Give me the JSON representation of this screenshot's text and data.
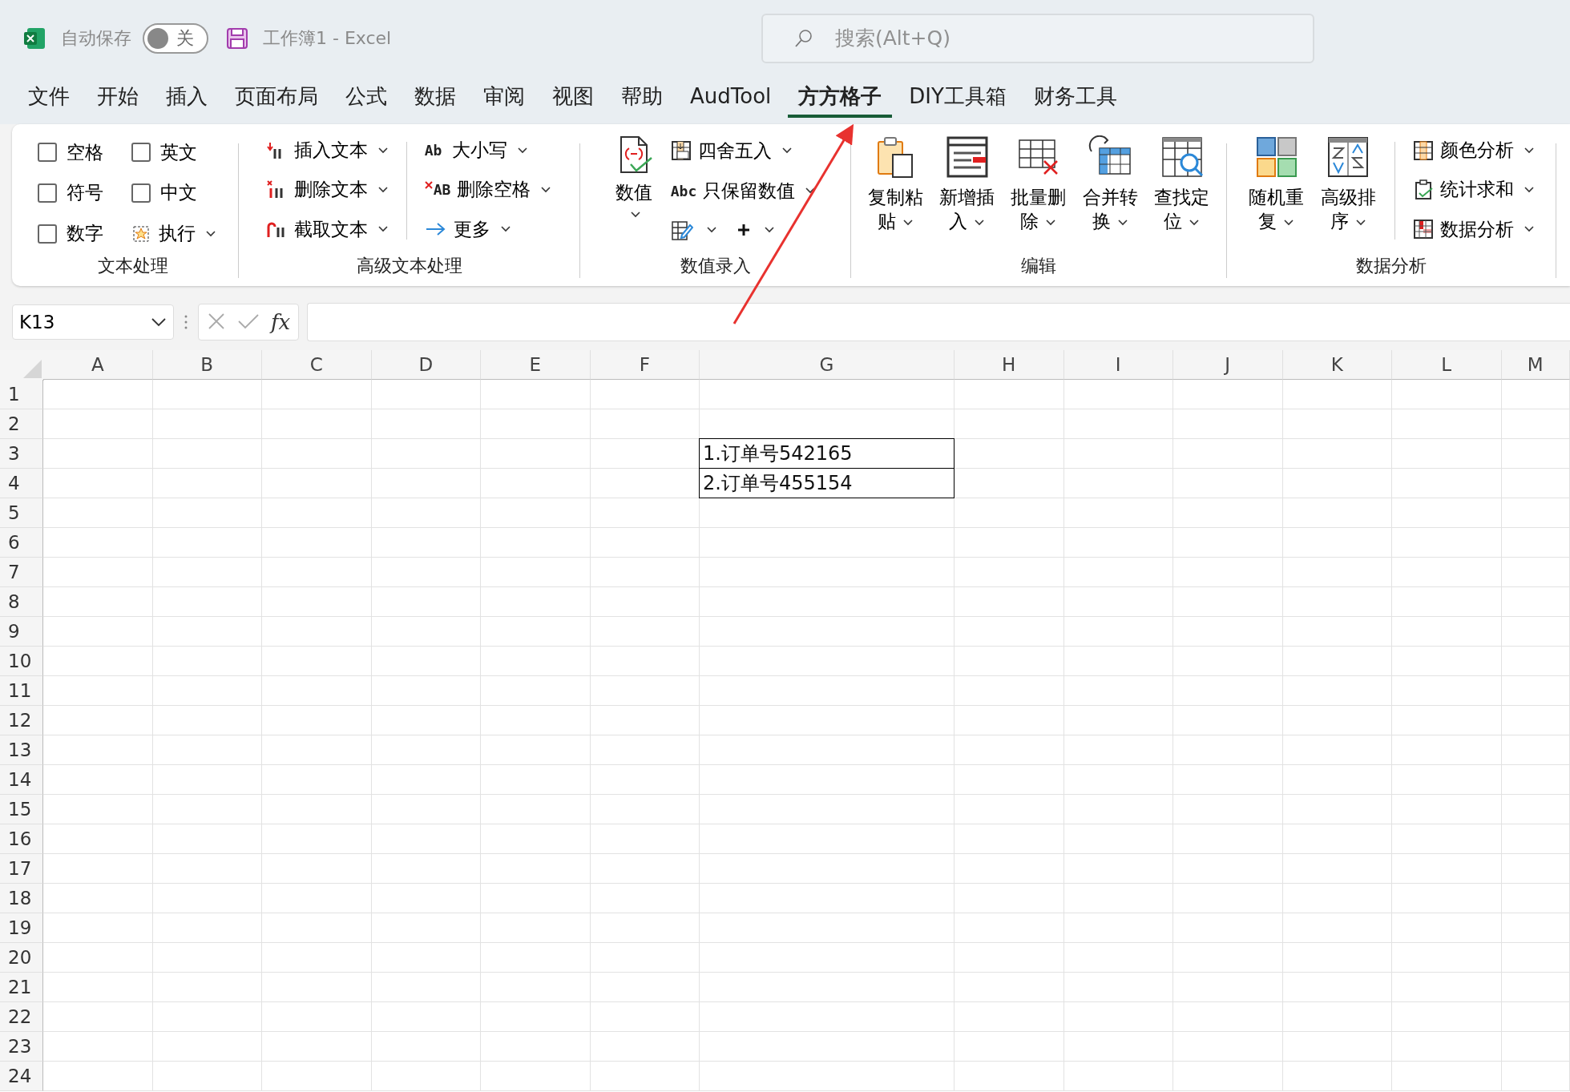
{
  "titlebar": {
    "autosave_label": "自动保存",
    "autosave_toggle": {
      "label": "关",
      "on": false
    },
    "document_title": "工作簿1  -  Excel",
    "search": {
      "placeholder": "搜索(Alt+Q)"
    }
  },
  "tabs": [
    {
      "label": "文件",
      "selected": false
    },
    {
      "label": "开始",
      "selected": false
    },
    {
      "label": "插入",
      "selected": false
    },
    {
      "label": "页面布局",
      "selected": false
    },
    {
      "label": "公式",
      "selected": false
    },
    {
      "label": "数据",
      "selected": false
    },
    {
      "label": "审阅",
      "selected": false
    },
    {
      "label": "视图",
      "selected": false
    },
    {
      "label": "帮助",
      "selected": false
    },
    {
      "label": "AudTool",
      "selected": false
    },
    {
      "label": "方方格子",
      "selected": true
    },
    {
      "label": "DIY工具箱",
      "selected": false
    },
    {
      "label": "财务工具",
      "selected": false
    }
  ],
  "ribbon": [
    {
      "label": "文本处理",
      "sections": [
        {
          "kind": "grid",
          "items": [
            {
              "kind": "checkbox",
              "label": "空格",
              "checked": false
            },
            {
              "kind": "checkbox",
              "label": "英文",
              "checked": false
            },
            {
              "kind": "checkbox",
              "label": "符号",
              "checked": false
            },
            {
              "kind": "checkbox",
              "label": "中文",
              "checked": false
            },
            {
              "kind": "checkbox",
              "label": "数字",
              "checked": false
            },
            {
              "kind": "small",
              "label": "执行",
              "dropdown": true
            }
          ]
        }
      ]
    },
    {
      "label": "高级文本处理",
      "sections": [
        {
          "kind": "column",
          "items": [
            {
              "kind": "small",
              "label": "插入文本",
              "dropdown": true
            },
            {
              "kind": "small",
              "label": "删除文本",
              "dropdown": true
            },
            {
              "kind": "small",
              "label": "截取文本",
              "dropdown": true
            }
          ]
        },
        {
          "kind": "divider"
        },
        {
          "kind": "column",
          "items": [
            {
              "kind": "small",
              "icon_text": "Ab",
              "label": "大小写",
              "dropdown": true
            },
            {
              "kind": "small",
              "icon_text": "AB",
              "label": "删除空格",
              "dropdown": true
            },
            {
              "kind": "small",
              "label": "更多",
              "dropdown": true
            }
          ]
        }
      ]
    },
    {
      "label": "数值录入",
      "sections": [
        {
          "kind": "large",
          "items": [
            {
              "kind": "large",
              "label": "数值",
              "dropdown": true
            }
          ]
        },
        {
          "kind": "column",
          "items": [
            {
              "kind": "small",
              "label": "四舍五入",
              "dropdown": true
            },
            {
              "kind": "small",
              "icon_text": "Abc",
              "label": "只保留数值",
              "dropdown": true
            },
            {
              "kind": "pair",
              "dropdown": true
            }
          ]
        }
      ]
    },
    {
      "label": "编辑",
      "sections": [
        {
          "kind": "large",
          "items": [
            {
              "kind": "large",
              "label": "复制粘贴",
              "dropdown": true
            },
            {
              "kind": "large",
              "label": "新增插入",
              "dropdown": true
            },
            {
              "kind": "large",
              "label": "批量删除",
              "dropdown": true
            },
            {
              "kind": "large",
              "label": "合并转换",
              "dropdown": true
            },
            {
              "kind": "large",
              "label": "查找定位",
              "dropdown": true
            }
          ]
        }
      ]
    },
    {
      "label": "数据分析",
      "sections": [
        {
          "kind": "large",
          "items": [
            {
              "kind": "large",
              "label": "随机重复",
              "dropdown": true
            },
            {
              "kind": "large",
              "label": "高级排序",
              "dropdown": true
            }
          ]
        },
        {
          "kind": "divider"
        },
        {
          "kind": "column",
          "items": [
            {
              "kind": "small",
              "label": "颜色分析",
              "dropdown": true
            },
            {
              "kind": "small",
              "label": "统计求和",
              "dropdown": true
            },
            {
              "kind": "small",
              "label": "数据分析",
              "dropdown": true
            }
          ]
        }
      ]
    }
  ],
  "formula_bar": {
    "name_box": "K13",
    "function_label": "fx"
  },
  "sheet": {
    "columns": [
      "A",
      "B",
      "C",
      "D",
      "E",
      "F",
      "G",
      "H",
      "I",
      "J",
      "K",
      "L",
      "M"
    ],
    "rows": [
      {
        "label": "1"
      },
      {
        "label": "2"
      },
      {
        "label": "3",
        "cells": {
          "G": {
            "text": "1.订单号542165",
            "bordered": true
          }
        }
      },
      {
        "label": "4",
        "cells": {
          "G": {
            "text": "2.订单号455154",
            "bordered": true
          }
        }
      },
      {
        "label": "5"
      },
      {
        "label": "6"
      },
      {
        "label": "7"
      },
      {
        "label": "8"
      },
      {
        "label": "9"
      },
      {
        "label": "10"
      },
      {
        "label": "11"
      },
      {
        "label": "12"
      },
      {
        "label": "13"
      },
      {
        "label": "14"
      },
      {
        "label": "15"
      },
      {
        "label": "16"
      },
      {
        "label": "17"
      },
      {
        "label": "18"
      },
      {
        "label": "19"
      },
      {
        "label": "20"
      },
      {
        "label": "21"
      },
      {
        "label": "22"
      },
      {
        "label": "23"
      },
      {
        "label": "24"
      }
    ]
  }
}
